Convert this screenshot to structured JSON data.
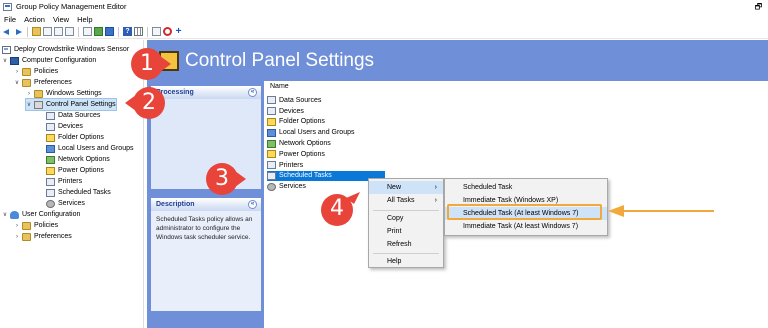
{
  "window": {
    "title": "Group Policy Management Editor",
    "restore_glyph": "🗗"
  },
  "menu": [
    "File",
    "Action",
    "View",
    "Help"
  ],
  "toolbar_icons": [
    "back-arrow-icon",
    "forward-arrow-icon",
    "up-folder-icon",
    "doc-icon",
    "copy-icon",
    "paste-icon",
    "print-icon",
    "refresh-icon",
    "export-icon",
    "help-icon",
    "view-icon",
    "properties-icon",
    "block-icon",
    "add-icon"
  ],
  "tree": {
    "root": "Deploy Crowdstrike Windows Sensor",
    "computer_configuration": "Computer Configuration",
    "policies": "Policies",
    "preferences": "Preferences",
    "windows_settings": "Windows Settings",
    "control_panel_settings": "Control Panel Settings",
    "cps_children": [
      "Data Sources",
      "Devices",
      "Folder Options",
      "Local Users and Groups",
      "Network Options",
      "Power Options",
      "Printers",
      "Scheduled Tasks",
      "Services"
    ],
    "user_configuration": "User Configuration",
    "user_policies": "Policies",
    "user_preferences": "Preferences"
  },
  "header": {
    "title": "Control Panel Settings"
  },
  "side": {
    "processing_label": "Processing",
    "description_label": "Description",
    "description_text": "Scheduled Tasks policy allows an administrator to configure the Windows task scheduler service."
  },
  "list": {
    "column_name": "Name",
    "items": [
      "Data Sources",
      "Devices",
      "Folder Options",
      "Local Users and Groups",
      "Network Options",
      "Power Options",
      "Printers",
      "Scheduled Tasks",
      "Services"
    ],
    "selected": "Scheduled Tasks"
  },
  "context_menu": {
    "items": [
      "New",
      "All Tasks",
      "Copy",
      "Print",
      "Refresh",
      "Help"
    ],
    "submenu_arrow": "›"
  },
  "submenu": {
    "items": [
      "Scheduled Task",
      "Immediate Task (Windows XP)",
      "Scheduled Task (At least Windows 7)",
      "Immediate Task (At least Windows 7)"
    ],
    "highlighted": "Scheduled Task (At least Windows 7)"
  },
  "callouts": [
    "1",
    "2",
    "3",
    "4"
  ],
  "colors": {
    "header_blue": "#6f8fd8",
    "callout_red": "#e8443a",
    "highlight_orange": "#f2a93b",
    "selection_blue": "#0a78d7"
  }
}
